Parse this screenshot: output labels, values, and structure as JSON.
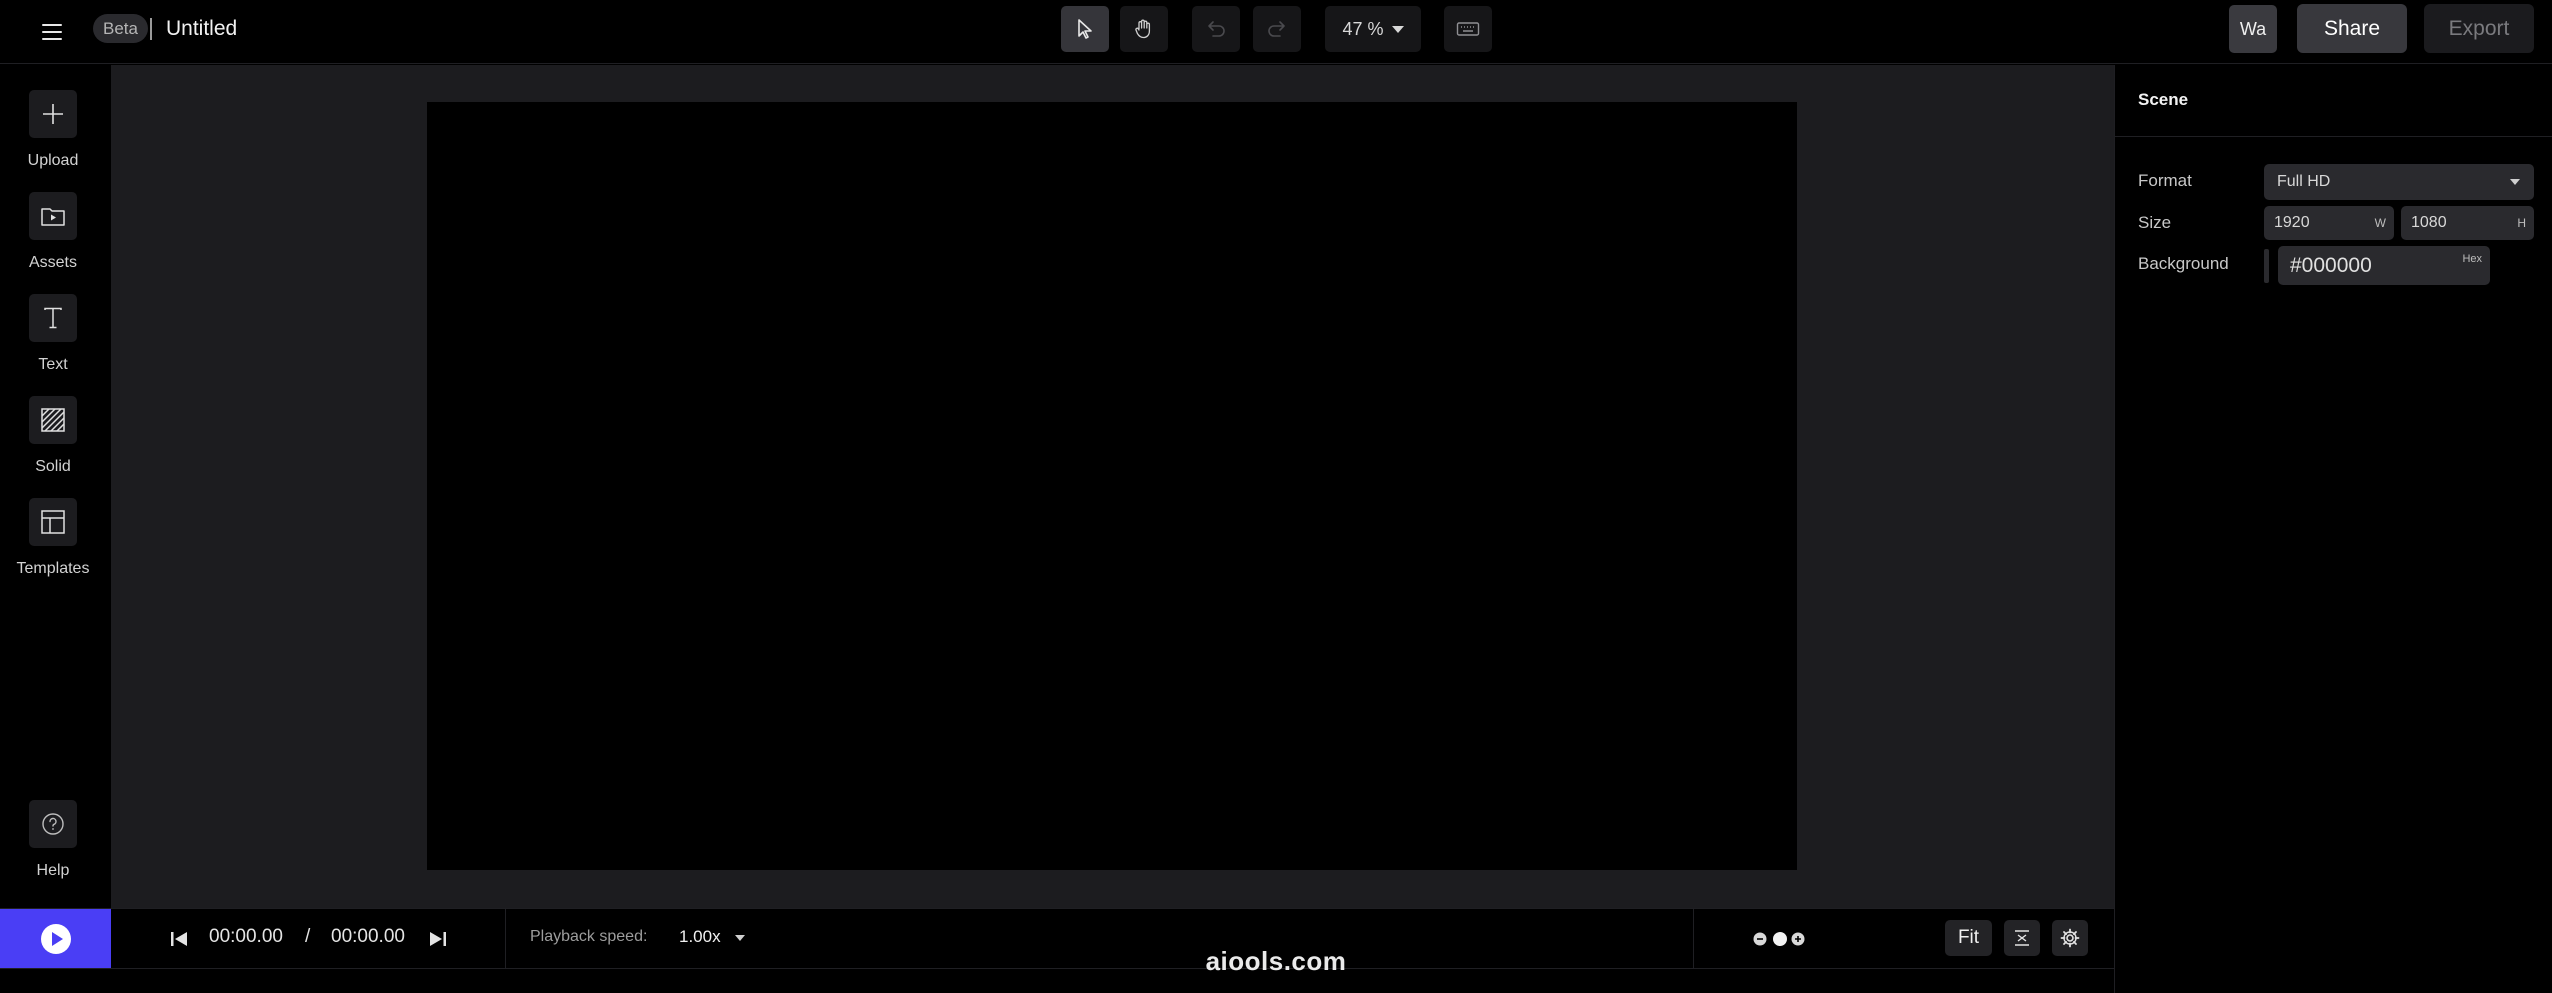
{
  "app": {
    "beta_label": "Beta",
    "document_title": "Untitled"
  },
  "toolbar": {
    "zoom_value": "47 %",
    "avatar_initials": "Wa",
    "share_label": "Share",
    "export_label": "Export"
  },
  "sidebar": {
    "items": [
      {
        "label": "Upload",
        "icon": "plus-icon"
      },
      {
        "label": "Assets",
        "icon": "folder-play-icon"
      },
      {
        "label": "Text",
        "icon": "text-t-icon"
      },
      {
        "label": "Solid",
        "icon": "hatch-square-icon"
      },
      {
        "label": "Templates",
        "icon": "layout-icon"
      }
    ],
    "help_label": "Help"
  },
  "panel": {
    "title": "Scene",
    "format_label": "Format",
    "format_value": "Full HD",
    "size_label": "Size",
    "width_value": "1920",
    "width_unit": "W",
    "height_value": "1080",
    "height_unit": "H",
    "background_label": "Background",
    "background_hex": "#000000",
    "hex_unit": "Hex"
  },
  "playback": {
    "current_time": "00:00.00",
    "separator": "/",
    "total_time": "00:00.00",
    "speed_label": "Playback speed:",
    "speed_value": "1.00x",
    "fit_label": "Fit"
  },
  "watermark": "aiools.com",
  "colors": {
    "accent": "#4a3ef5",
    "scene_background": "#000000"
  }
}
